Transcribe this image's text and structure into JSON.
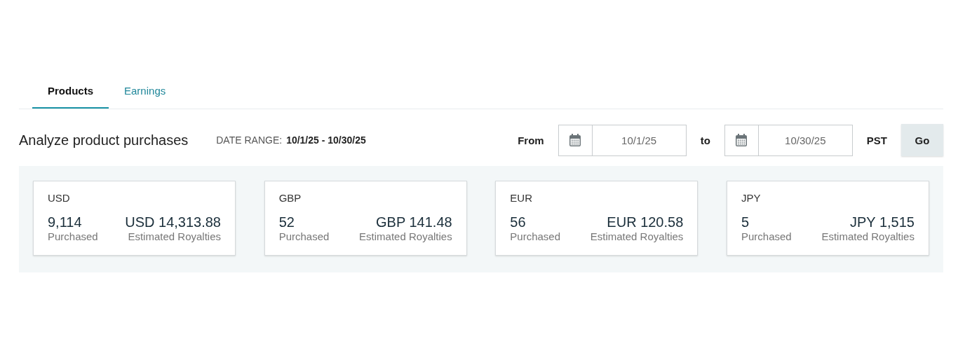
{
  "tabs": [
    {
      "label": "Products",
      "selected": true
    },
    {
      "label": "Earnings",
      "selected": false
    }
  ],
  "header": {
    "title": "Analyze product purchases",
    "range_label": "DATE RANGE:",
    "range_value": "10/1/25 - 10/30/25",
    "from_label": "From",
    "from_value": "10/1/25",
    "to_label": "to",
    "to_value": "10/30/25",
    "timezone": "PST",
    "go_button": "Go"
  },
  "cards": [
    {
      "currency": "USD",
      "purchased": "9,114",
      "purchased_label": "Purchased",
      "royalties": "USD 14,313.88",
      "royalties_label": "Estimated Royalties"
    },
    {
      "currency": "GBP",
      "purchased": "52",
      "purchased_label": "Purchased",
      "royalties": "GBP 141.48",
      "royalties_label": "Estimated Royalties"
    },
    {
      "currency": "EUR",
      "purchased": "56",
      "purchased_label": "Purchased",
      "royalties": "EUR 120.58",
      "royalties_label": "Estimated Royalties"
    },
    {
      "currency": "JPY",
      "purchased": "5",
      "purchased_label": "Purchased",
      "royalties": "JPY 1,515",
      "royalties_label": "Estimated Royalties"
    }
  ]
}
